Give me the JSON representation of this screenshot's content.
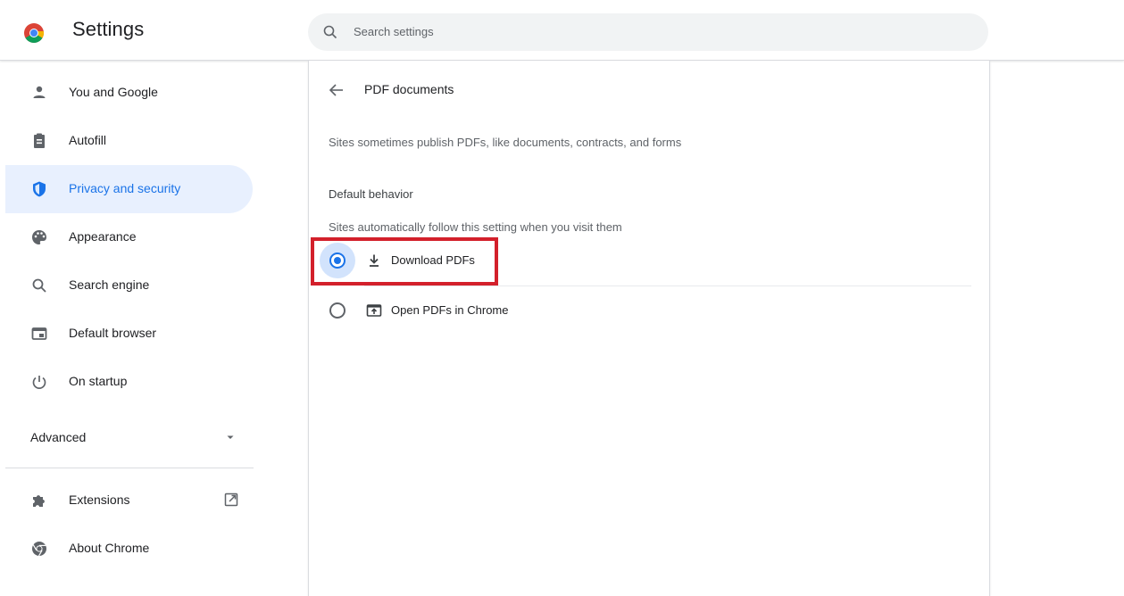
{
  "header": {
    "app_title": "Settings",
    "logo_icon": "chrome-logo-icon",
    "search": {
      "placeholder": "Search settings",
      "icon": "search-icon"
    }
  },
  "sidebar": {
    "items": [
      {
        "label": "You and Google",
        "icon": "person-icon",
        "selected": false
      },
      {
        "label": "Autofill",
        "icon": "clipboard-icon",
        "selected": false
      },
      {
        "label": "Privacy and security",
        "icon": "shield-icon",
        "selected": true
      },
      {
        "label": "Appearance",
        "icon": "palette-icon",
        "selected": false
      },
      {
        "label": "Search engine",
        "icon": "search-icon",
        "selected": false
      },
      {
        "label": "Default browser",
        "icon": "browser-window-icon",
        "selected": false
      },
      {
        "label": "On startup",
        "icon": "power-icon",
        "selected": false
      }
    ],
    "advanced": {
      "label": "Advanced",
      "icon": "caret-down-icon"
    },
    "extra_items": [
      {
        "label": "Extensions",
        "icon": "puzzle-icon",
        "trailing_icon": "open-in-new-icon"
      },
      {
        "label": "About Chrome",
        "icon": "chrome-outline-icon"
      }
    ]
  },
  "main": {
    "page_title": "PDF documents",
    "back_icon": "arrow-back-icon",
    "description": "Sites sometimes publish PDFs, like documents, contracts, and forms",
    "default_behavior": {
      "heading": "Default behavior",
      "subtext": "Sites automatically follow this setting when you visit them",
      "options": [
        {
          "label": "Download PDFs",
          "icon": "download-icon",
          "checked": true
        },
        {
          "label": "Open PDFs in Chrome",
          "icon": "open-in-window-icon",
          "checked": false
        }
      ]
    }
  },
  "colors": {
    "accent": "#1a73e8",
    "selected_bg": "#e8f0fe",
    "highlight_border": "#d3202b",
    "secondary_text": "#5f6368"
  }
}
